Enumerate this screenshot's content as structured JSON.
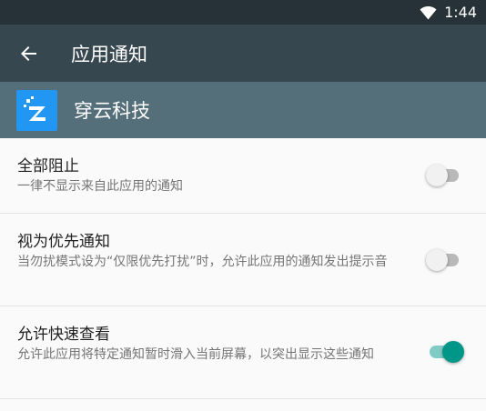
{
  "status_bar": {
    "time": "1:44",
    "icons": [
      "wifi-icon"
    ]
  },
  "toolbar": {
    "title": "应用通知",
    "back_icon": "arrow-back-icon"
  },
  "app": {
    "name": "穿云科技",
    "icon": "app-logo-icon"
  },
  "settings": [
    {
      "title": "全部阻止",
      "summary": "一律不显示来自此应用的通知",
      "enabled": false
    },
    {
      "title": "视为优先通知",
      "summary": "当勿扰模式设为“仅限优先打扰”时，允许此应用的通知发出提示音",
      "enabled": false
    },
    {
      "title": "允许快速查看",
      "summary": "允许此应用将特定通知暂时滑入当前屏幕，以突出显示这些通知",
      "enabled": true
    }
  ],
  "colors": {
    "status_bar": "#263238",
    "toolbar": "#37474f",
    "app_header": "#546e7a",
    "accent": "#009688",
    "accent_track": "#80cbc4"
  }
}
